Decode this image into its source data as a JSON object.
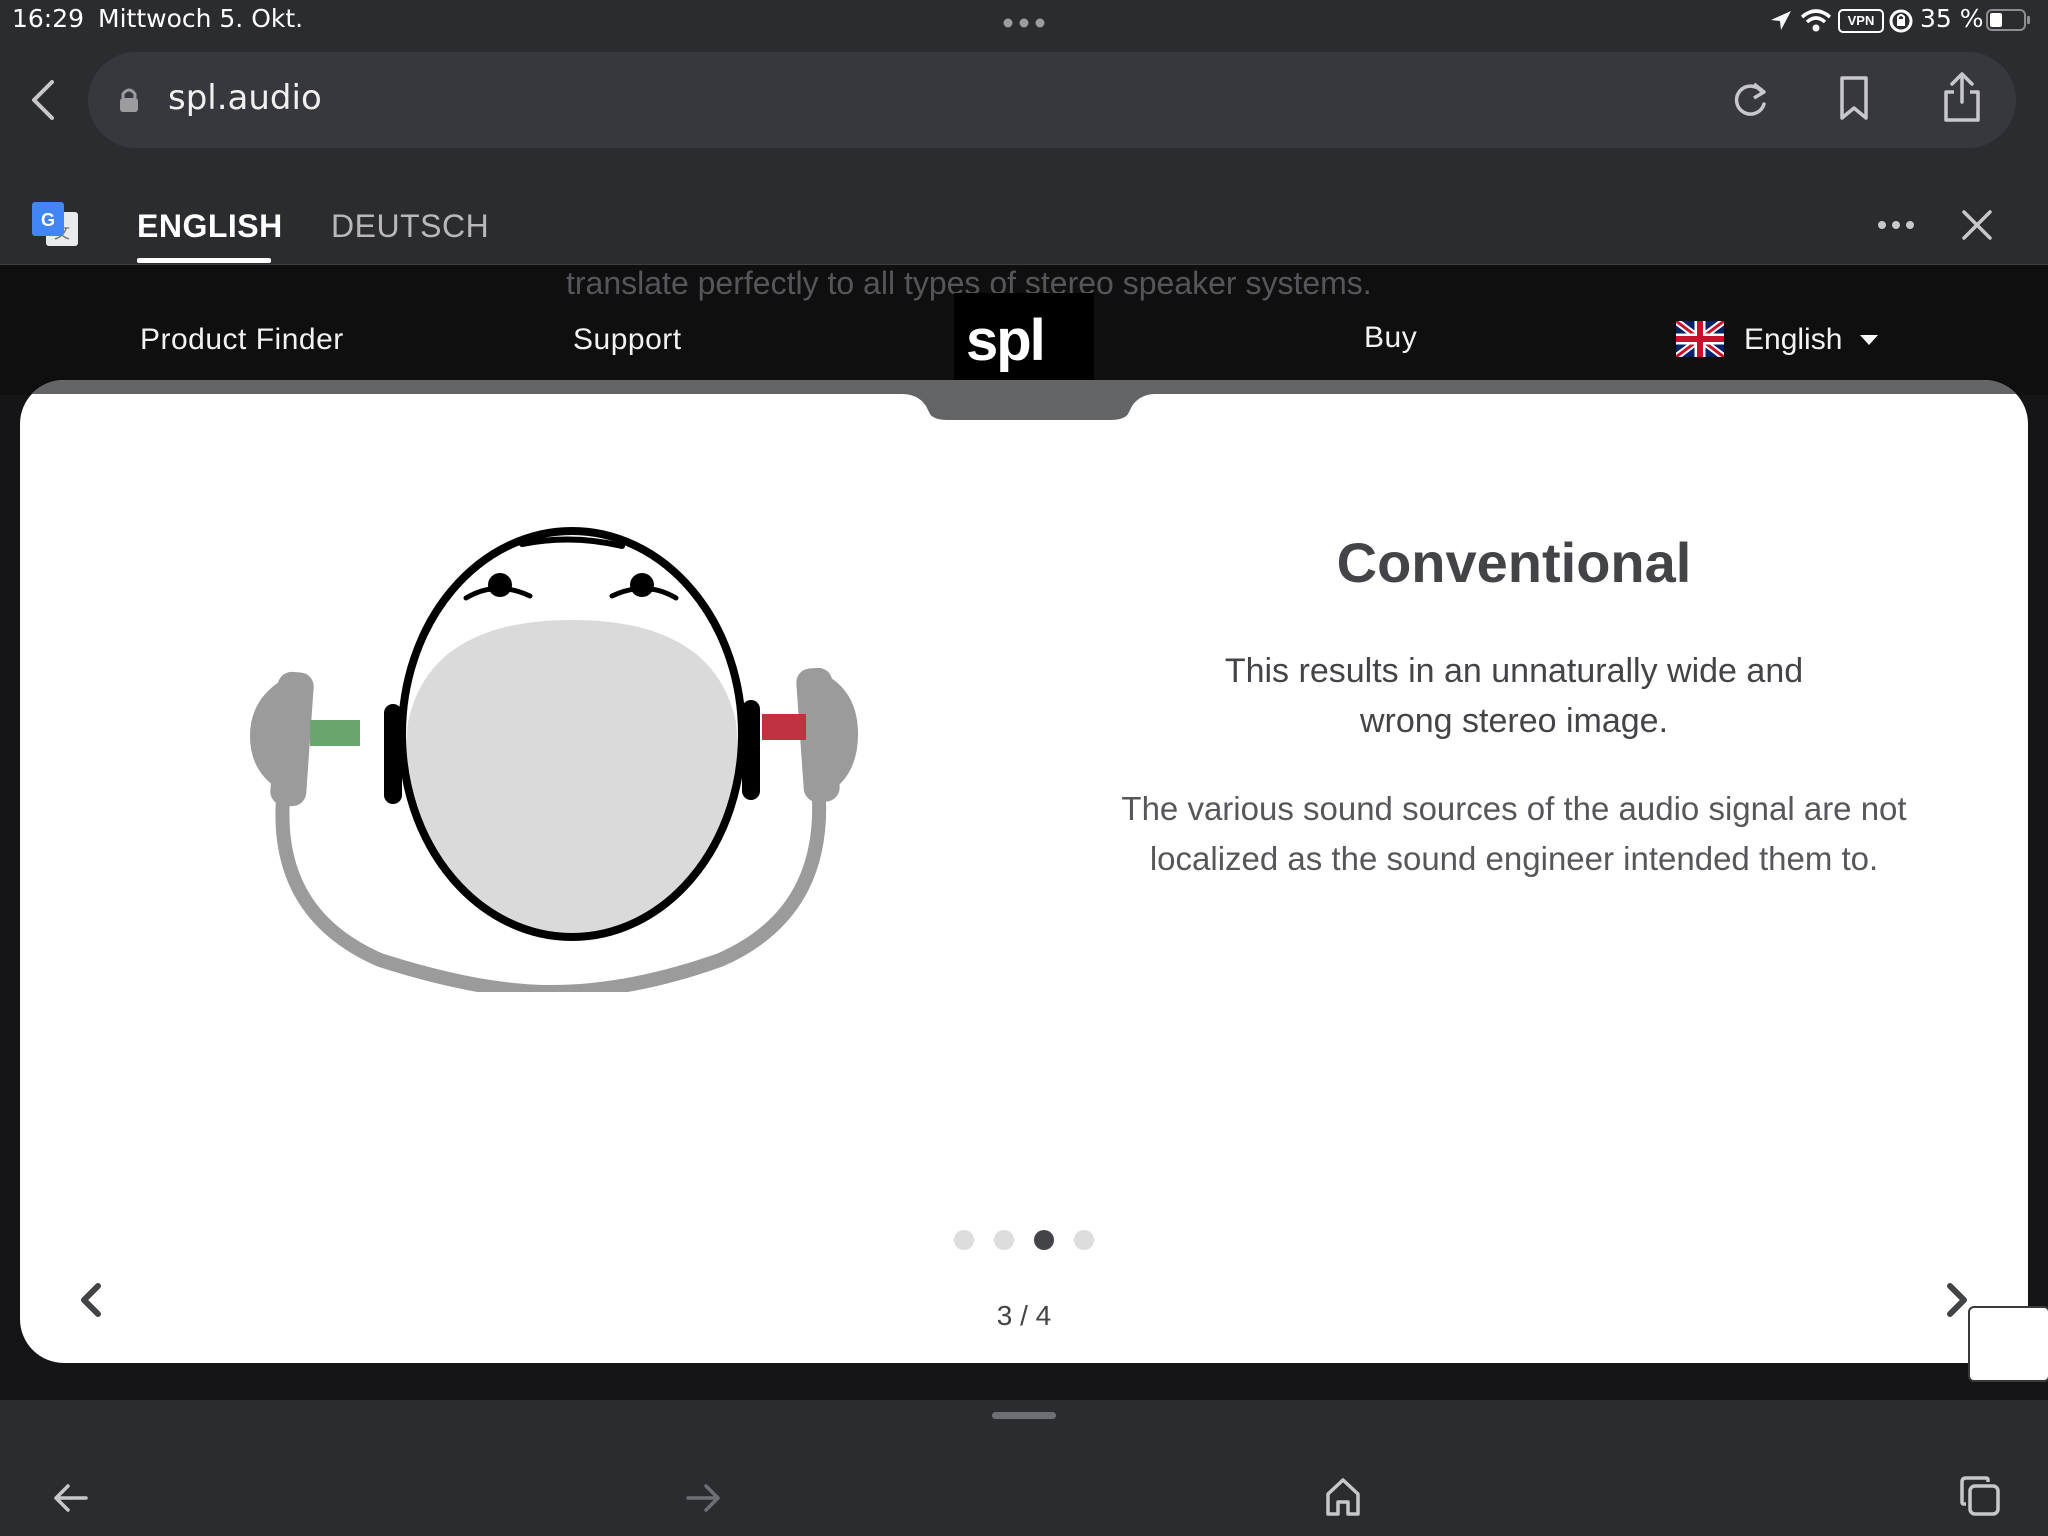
{
  "status_bar": {
    "time": "16:29",
    "date": "Mittwoch 5. Okt.",
    "vpn": "VPN",
    "battery": "35 %",
    "icons": [
      "location-icon",
      "wifi-icon",
      "vpn-icon",
      "rotation-lock-icon",
      "battery-icon"
    ]
  },
  "browser": {
    "url": "spl.audio",
    "icons": [
      "back-icon",
      "lock-icon",
      "reload-icon",
      "bookmark-icon",
      "share-icon"
    ]
  },
  "translate": {
    "tab_english": "ENGLISH",
    "tab_deutsch": "DEUTSCH",
    "icons": [
      "google-translate-icon",
      "more-icon",
      "close-icon"
    ]
  },
  "site": {
    "scrolled_text": "translate perfectly to all types of stereo speaker systems.",
    "nav_product_finder": "Product Finder",
    "nav_support": "Support",
    "logo": "spl",
    "nav_buy": "Buy",
    "language": "English"
  },
  "slide": {
    "title": "Conventional",
    "subtitle_line1": "This results in an unnaturally wide and",
    "subtitle_line2": "wrong stereo image.",
    "body_line1": "The various sound sources of the audio signal are not",
    "body_line2": "localized as the sound engineer intended them to.",
    "counter": "3 / 4",
    "current": 3,
    "total": 4,
    "colors": {
      "left_channel": "#6aa56e",
      "right_channel": "#c0323f"
    }
  },
  "bottom_bar": {
    "icons": [
      "back-arrow-icon",
      "forward-arrow-icon",
      "home-icon",
      "tabs-icon"
    ]
  }
}
